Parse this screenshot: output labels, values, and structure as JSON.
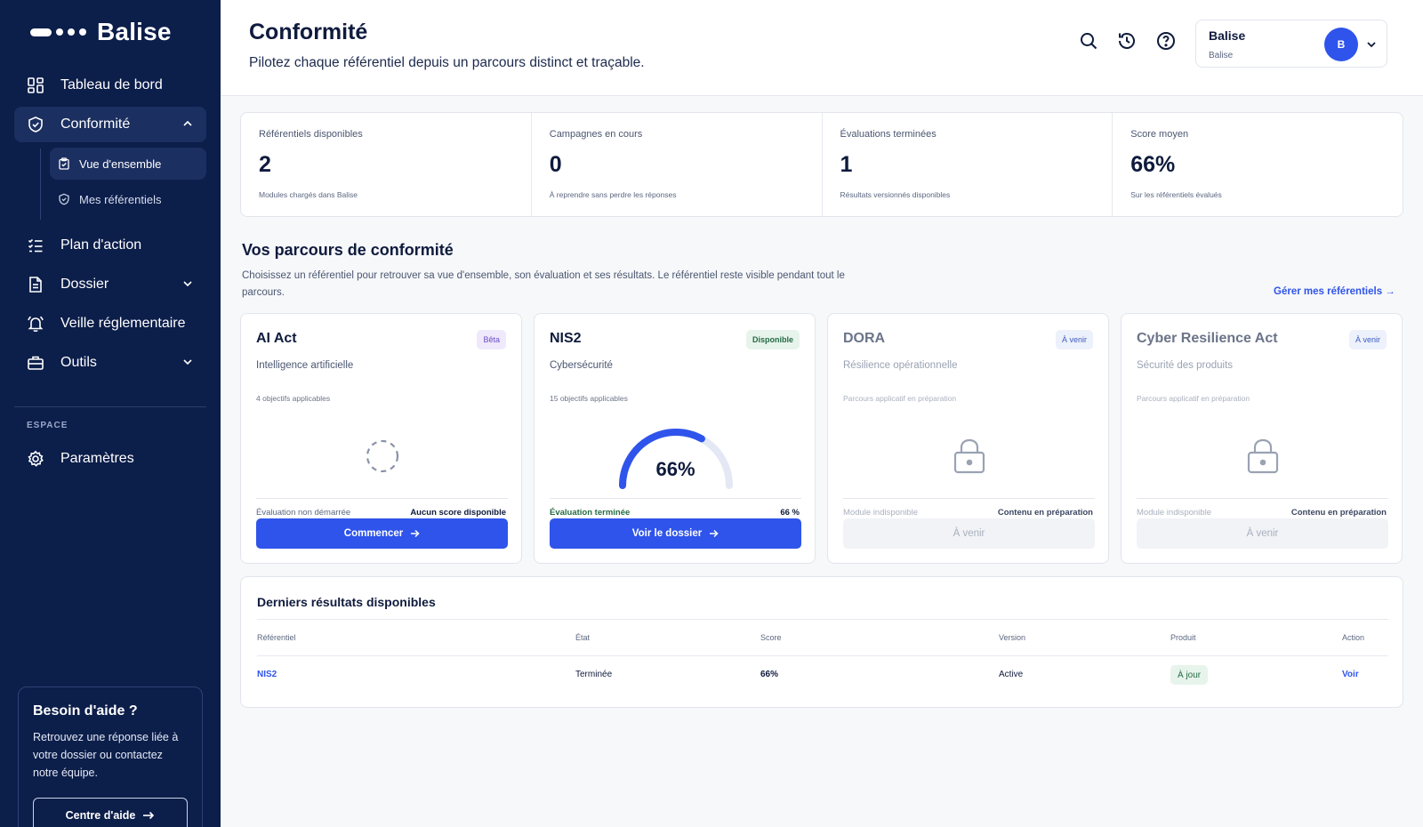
{
  "brand": {
    "name": "Balise"
  },
  "sidebar": {
    "nav": [
      {
        "label": "Tableau de bord",
        "icon": "dashboard-icon"
      },
      {
        "label": "Conformité",
        "icon": "shield-check-icon"
      },
      {
        "label": "Plan d'action",
        "icon": "checklist-icon"
      },
      {
        "label": "Dossier",
        "icon": "document-icon"
      },
      {
        "label": "Veille réglementaire",
        "icon": "bell-icon"
      },
      {
        "label": "Outils",
        "icon": "toolbox-icon"
      }
    ],
    "sub": [
      {
        "label": "Vue d'ensemble",
        "icon": "clipboard-check-icon"
      },
      {
        "label": "Mes référentiels",
        "icon": "shield-check-icon"
      }
    ],
    "section_label": "ESPACE",
    "settings": {
      "label": "Paramètres",
      "icon": "gear-icon"
    },
    "help": {
      "title": "Besoin d'aide ?",
      "text": "Retrouvez une réponse liée à votre dossier ou contactez notre équipe.",
      "button": "Centre d'aide"
    }
  },
  "header": {
    "title": "Conformité",
    "subtitle": "Pilotez chaque référentiel depuis un parcours distinct et traçable.",
    "user": {
      "name": "Balise",
      "org": "Balise",
      "initial": "B"
    }
  },
  "stats": [
    {
      "label": "Référentiels disponibles",
      "value": "2",
      "note": "Modules chargés dans Balise"
    },
    {
      "label": "Campagnes en cours",
      "value": "0",
      "note": "À reprendre sans perdre les réponses"
    },
    {
      "label": "Évaluations terminées",
      "value": "1",
      "note": "Résultats versionnés disponibles"
    },
    {
      "label": "Score moyen",
      "value": "66%",
      "note": "Sur les référentiels évalués"
    }
  ],
  "section": {
    "title": "Vos parcours de conformité",
    "description": "Choisissez un référentiel pour retrouver sa vue d'ensemble, son évaluation et ses résultats. Le référentiel reste visible pendant tout le parcours.",
    "manage_link": "Gérer mes référentiels →"
  },
  "cards": [
    {
      "title": "AI Act",
      "badge": "Bêta",
      "subtitle": "Intelligence artificielle",
      "objectives": "4 objectifs applicables",
      "status": "Évaluation non démarrée",
      "meta": "Aucun score disponible",
      "button": "Commencer"
    },
    {
      "title": "NIS2",
      "badge": "Disponible",
      "subtitle": "Cybersécurité",
      "objectives": "15 objectifs applicables",
      "gauge_label": "66%",
      "gauge_value": 66,
      "status": "Évaluation terminée",
      "meta": "66 %",
      "button": "Voir le dossier"
    },
    {
      "title": "DORA",
      "badge": "À venir",
      "subtitle": "Résilience opérationnelle",
      "objectives": "Parcours applicatif en préparation",
      "status": "Module indisponible",
      "meta": "Contenu en préparation",
      "button": "À venir"
    },
    {
      "title": "Cyber Resilience Act",
      "badge": "À venir",
      "subtitle": "Sécurité des produits",
      "objectives": "Parcours applicatif en préparation",
      "status": "Module indisponible",
      "meta": "Contenu en préparation",
      "button": "À venir"
    }
  ],
  "results": {
    "title": "Derniers résultats disponibles",
    "columns": [
      "Référentiel",
      "État",
      "Score",
      "Version",
      "Produit",
      "Action"
    ],
    "rows": [
      {
        "ref": "NIS2",
        "state": "Terminée",
        "score": "66%",
        "version": "Active",
        "product": "À jour",
        "action": "Voir"
      }
    ]
  },
  "colors": {
    "sidebar": "#0c1e4a",
    "accent": "#2f54eb",
    "success": "#256a43"
  }
}
